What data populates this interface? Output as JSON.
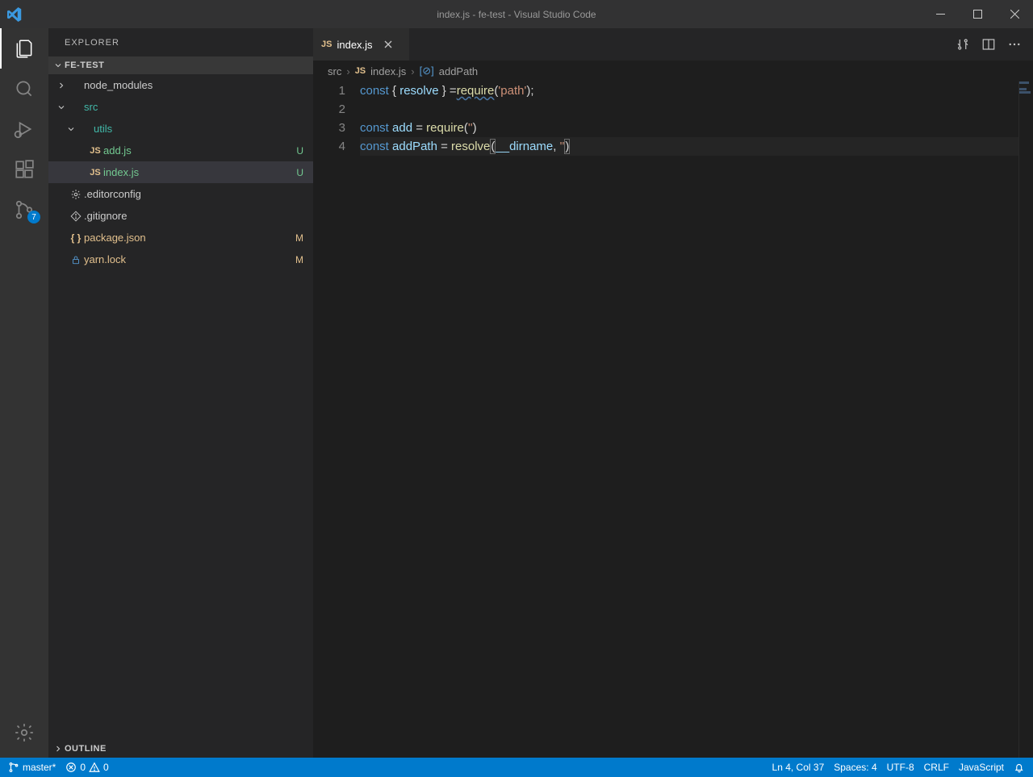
{
  "titlebar": {
    "title": "index.js - fe-test - Visual Studio Code"
  },
  "sidebar": {
    "title": "EXPLORER",
    "section_label": "FE-TEST",
    "outline_label": "OUTLINE",
    "tree": [
      {
        "name": "node_modules",
        "type": "folder",
        "expanded": false,
        "indent": 0,
        "tint": "default"
      },
      {
        "name": "src",
        "type": "folder",
        "expanded": true,
        "indent": 0,
        "tint": "teal",
        "deco": "dot"
      },
      {
        "name": "utils",
        "type": "folder",
        "expanded": true,
        "indent": 1,
        "tint": "teal",
        "deco": "dot"
      },
      {
        "name": "add.js",
        "type": "js",
        "indent": 2,
        "git": "U"
      },
      {
        "name": "index.js",
        "type": "js",
        "indent": 2,
        "git": "U",
        "selected": true
      },
      {
        "name": ".editorconfig",
        "type": "config",
        "indent": 0
      },
      {
        "name": ".gitignore",
        "type": "git",
        "indent": 0
      },
      {
        "name": "package.json",
        "type": "json",
        "indent": 0,
        "git": "M"
      },
      {
        "name": "yarn.lock",
        "type": "lock",
        "indent": 0,
        "git": "M"
      }
    ]
  },
  "scm_badge": "7",
  "tab": {
    "filename": "index.js"
  },
  "breadcrumbs": {
    "a": "src",
    "b": "index.js",
    "c": "addPath"
  },
  "code": {
    "lines": [
      {
        "n": 1
      },
      {
        "n": 2
      },
      {
        "n": 3
      },
      {
        "n": 4
      }
    ],
    "l1": {
      "const": "const",
      "resolve": "resolve",
      "eq": " =",
      "req": "require",
      "path": "'path'",
      "tail": ";"
    },
    "l3": {
      "const": "const",
      "add": "add",
      "eq": " = ",
      "req": "require",
      "str": "''"
    },
    "l4": {
      "const": "const",
      "addPath": "addPath",
      "eq": " = ",
      "resolve": "resolve",
      "dirname": "__dirname",
      "comma": ", ",
      "str": "''"
    }
  },
  "status": {
    "branch": "master*",
    "errors": "0",
    "warnings": "0",
    "lncol": "Ln 4, Col 37",
    "spaces": "Spaces: 4",
    "encoding": "UTF-8",
    "eol": "CRLF",
    "lang": "JavaScript"
  }
}
